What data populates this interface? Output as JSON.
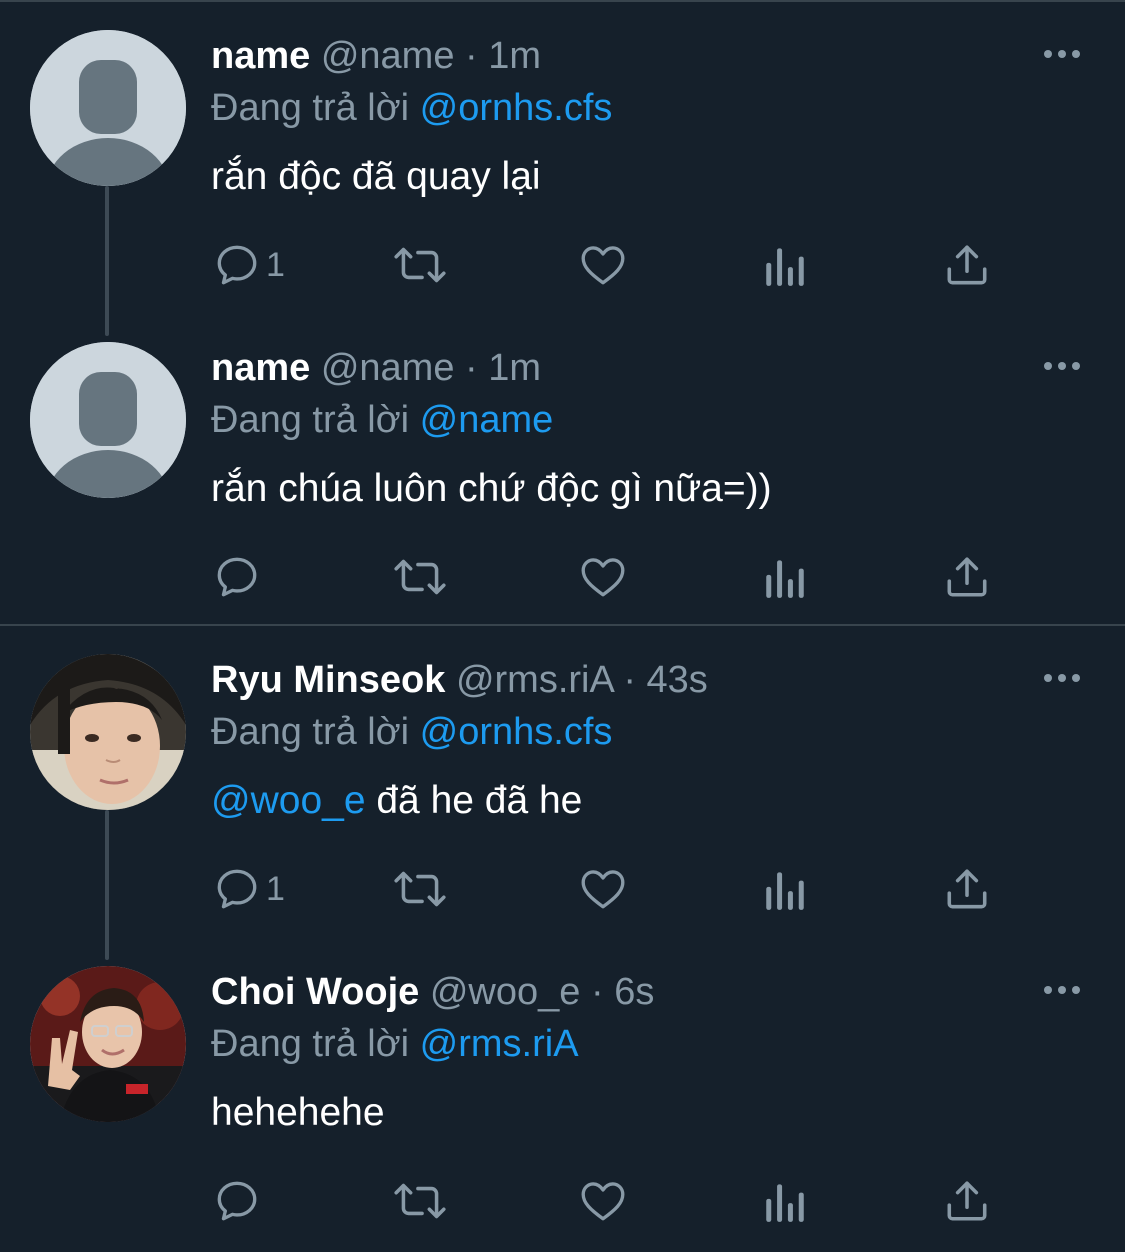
{
  "reply_prefix": "Đang trả lời",
  "tweets": [
    {
      "name": "name",
      "handle": "@name",
      "dot": "·",
      "time": "1m",
      "replying_to": "@ornhs.cfs",
      "mention": "",
      "text": "rắn độc đã quay lại",
      "reply_count": "1",
      "avatar": "default-avatar-icon"
    },
    {
      "name": "name",
      "handle": "@name",
      "dot": "·",
      "time": "1m",
      "replying_to": "@name",
      "mention": "",
      "text": "rắn chúa luôn chứ độc gì nữa=))",
      "reply_count": "",
      "avatar": "default-avatar-icon"
    },
    {
      "name": "Ryu Minseok",
      "handle": "@rms.riA",
      "dot": "·",
      "time": "43s",
      "replying_to": "@ornhs.cfs",
      "mention": "@woo_e",
      "text": " đã he đã he",
      "reply_count": "1",
      "avatar": "user-photo-avatar"
    },
    {
      "name": "Choi Wooje",
      "handle": "@woo_e",
      "dot": "·",
      "time": "6s",
      "replying_to": "@rms.riA",
      "mention": "",
      "text": "hehehehe",
      "reply_count": "",
      "avatar": "user-photo-avatar"
    }
  ],
  "colors": {
    "background": "#15202b",
    "secondary_text": "#8899a6",
    "link": "#1d9bf0",
    "divider": "#38444d"
  }
}
